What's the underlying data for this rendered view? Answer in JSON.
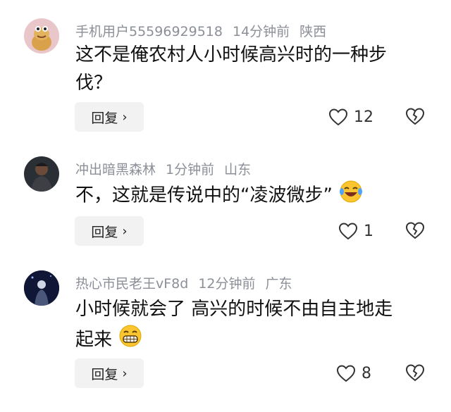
{
  "comments": [
    {
      "username": "手机用户55596929518",
      "time": "14分钟前",
      "location": "陕西",
      "text_line1": "这不是俺农村人小时候高兴时的一种步",
      "text_line2": "伐？",
      "reply_label": "回复",
      "likes": "12"
    },
    {
      "username": "冲出暗黑森林",
      "time": "1分钟前",
      "location": "山东",
      "text": "不，这就是传说中的“凌波微步”",
      "emoji": "laughing-tears-emoji",
      "reply_label": "回复",
      "likes": "1"
    },
    {
      "username": "热心市民老王vF8d",
      "time": "12分钟前",
      "location": "广东",
      "text_line1": "小时候就会了 高兴的时候不由自主地走",
      "text_line2": "起来",
      "emoji": "grinning-emoji",
      "reply_label": "回复",
      "likes": "8"
    }
  ],
  "colors": {
    "meta": "#8b8f97",
    "reply_bg": "#f2f2f3",
    "text": "#111111"
  }
}
